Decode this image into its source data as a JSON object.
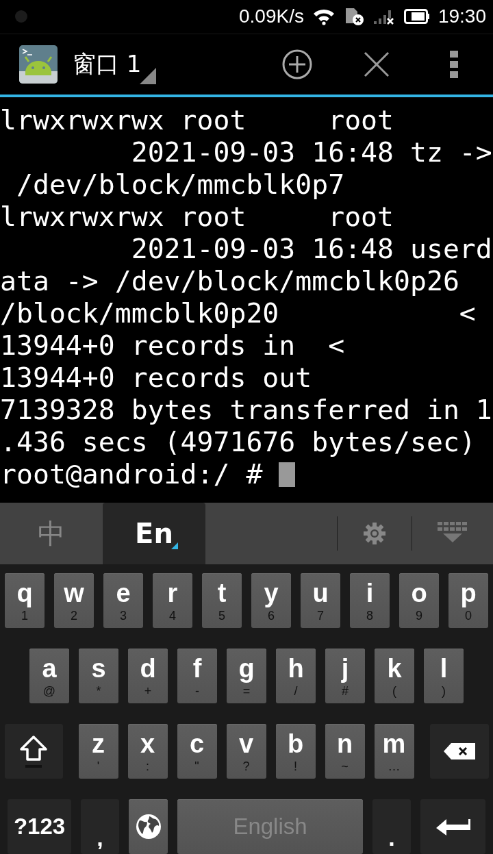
{
  "status_bar": {
    "net_speed": "0.09K/s",
    "time": "19:30"
  },
  "toolbar": {
    "title": "窗口 1"
  },
  "terminal": {
    "lines": [
      "lrwxrwxrwx root     root",
      "        2021-09-03 16:48 tz ->",
      " /dev/block/mmcblk0p7",
      "lrwxrwxrwx root     root",
      "        2021-09-03 16:48 userd",
      "ata -> /dev/block/mmcblk0p26",
      "/block/mmcblk0p20           <",
      "13944+0 records in  <",
      "13944+0 records out",
      "7139328 bytes transferred in 1",
      ".436 secs (4971676 bytes/sec)",
      "root@android:/ # "
    ]
  },
  "keyboard": {
    "tabs": [
      {
        "label": "中",
        "selected": false
      },
      {
        "label": "En",
        "selected": true
      }
    ],
    "row_1": [
      {
        "kind": "letter",
        "label": "q",
        "hint": "1"
      },
      {
        "kind": "letter",
        "label": "w",
        "hint": "2"
      },
      {
        "kind": "letter",
        "label": "e",
        "hint": "3"
      },
      {
        "kind": "letter",
        "label": "r",
        "hint": "4"
      },
      {
        "kind": "letter",
        "label": "t",
        "hint": "5"
      },
      {
        "kind": "letter",
        "label": "y",
        "hint": "6"
      },
      {
        "kind": "letter",
        "label": "u",
        "hint": "7"
      },
      {
        "kind": "letter",
        "label": "i",
        "hint": "8"
      },
      {
        "kind": "letter",
        "label": "o",
        "hint": "9"
      },
      {
        "kind": "letter",
        "label": "p",
        "hint": "0"
      }
    ],
    "row_2": [
      {
        "kind": "letter",
        "label": "a",
        "hint": "@"
      },
      {
        "kind": "letter",
        "label": "s",
        "hint": "*"
      },
      {
        "kind": "letter",
        "label": "d",
        "hint": "+"
      },
      {
        "kind": "letter",
        "label": "f",
        "hint": "-"
      },
      {
        "kind": "letter",
        "label": "g",
        "hint": "="
      },
      {
        "kind": "letter",
        "label": "h",
        "hint": "/"
      },
      {
        "kind": "letter",
        "label": "j",
        "hint": "#"
      },
      {
        "kind": "letter",
        "label": "k",
        "hint": "("
      },
      {
        "kind": "letter",
        "label": "l",
        "hint": ")"
      }
    ],
    "row_3": [
      {
        "kind": "shift"
      },
      {
        "kind": "letter",
        "label": "z",
        "hint": "'"
      },
      {
        "kind": "letter",
        "label": "x",
        "hint": ":"
      },
      {
        "kind": "letter",
        "label": "c",
        "hint": "\""
      },
      {
        "kind": "letter",
        "label": "v",
        "hint": "?"
      },
      {
        "kind": "letter",
        "label": "b",
        "hint": "!"
      },
      {
        "kind": "letter",
        "label": "n",
        "hint": "~"
      },
      {
        "kind": "letter",
        "label": "m",
        "hint": "…"
      },
      {
        "kind": "backspace"
      }
    ],
    "row_4": [
      {
        "kind": "mode",
        "label": "?123"
      },
      {
        "kind": "punct",
        "label": ","
      },
      {
        "kind": "globe"
      },
      {
        "kind": "space",
        "label": "English"
      },
      {
        "kind": "punct",
        "label": "."
      },
      {
        "kind": "enter"
      }
    ]
  }
}
